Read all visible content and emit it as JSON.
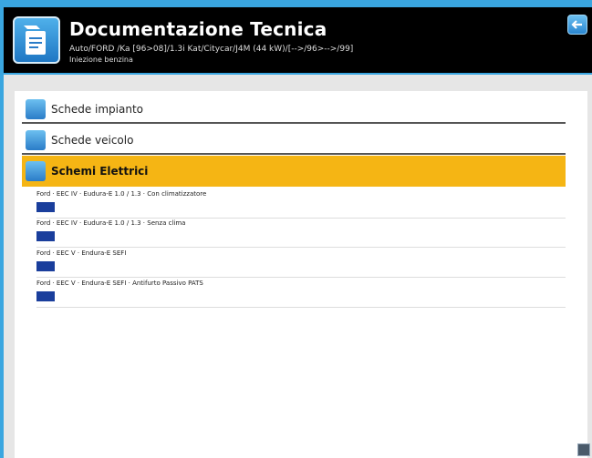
{
  "header": {
    "title": "Documentazione Tecnica",
    "subtitle": "Auto/FORD /Ka [96>08]/1.3i Kat/Citycar/J4M (44 kW)/[-->/96>-->/99]",
    "subtitle2": "Iniezione benzina"
  },
  "menu": [
    {
      "label": "Schede impianto",
      "icon": "document-icon"
    },
    {
      "label": "Schede veicolo",
      "icon": "document-icon"
    },
    {
      "label": "Schemi Elettrici",
      "icon": "wiring-icon",
      "active": true
    }
  ],
  "items": [
    {
      "text": "Ford · EEC IV · Eudura-E 1.0 / 1.3 · Con climatizzatore"
    },
    {
      "text": "Ford · EEC IV · Eudura-E 1.0 / 1.3 · Senza clima"
    },
    {
      "text": "Ford · EEC V · Endura-E SEFI"
    },
    {
      "text": "Ford · EEC V · Endura-E SEFI · Antifurto Passivo PATS"
    }
  ],
  "colors": {
    "accent": "#f5b514",
    "header_bg": "#000000",
    "frame": "#3aa6e0"
  }
}
